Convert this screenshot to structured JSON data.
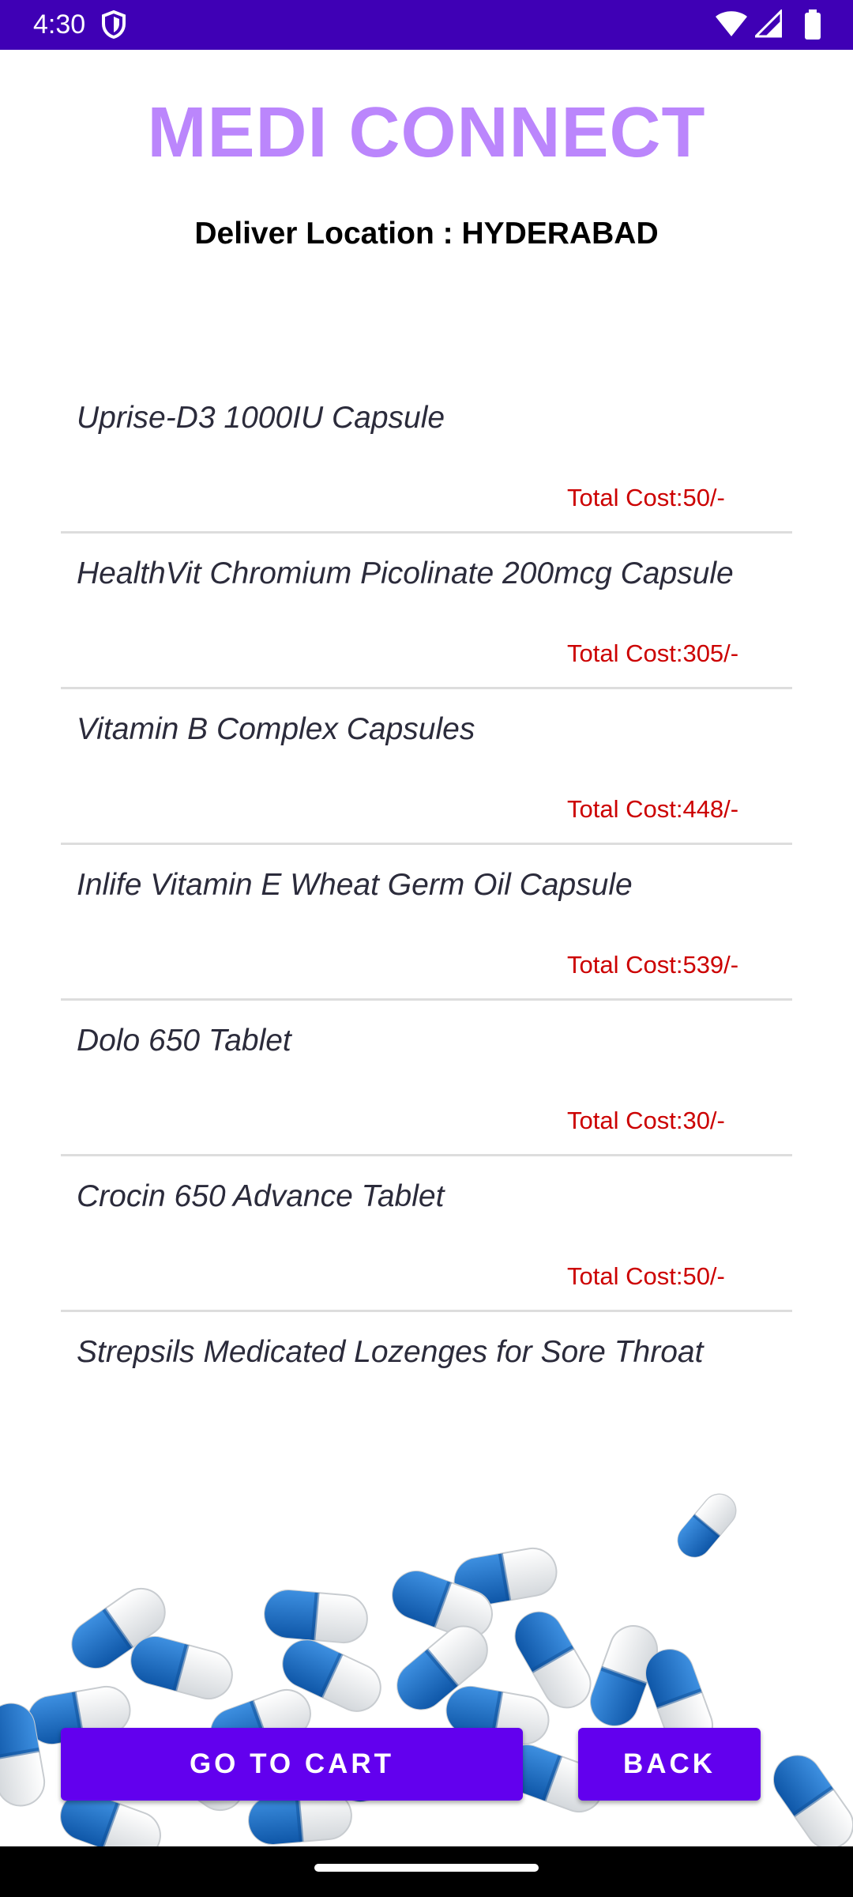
{
  "status_bar": {
    "time": "4:30",
    "icons": [
      "shield-icon",
      "wifi-icon",
      "cell-signal-icon",
      "battery-icon"
    ],
    "background": "#3f00b5"
  },
  "header": {
    "title": "MEDI CONNECT",
    "title_color": "#bb86fc",
    "deliver_location": "Deliver Location : HYDERABAD"
  },
  "medicines": [
    {
      "name": "Uprise-D3 1000IU Capsule",
      "cost": "Total Cost:50/-"
    },
    {
      "name": "HealthVit Chromium Picolinate 200mcg Capsule",
      "cost": "Total Cost:305/-"
    },
    {
      "name": "Vitamin B Complex Capsules",
      "cost": "Total Cost:448/-"
    },
    {
      "name": "Inlife Vitamin E Wheat Germ Oil Capsule",
      "cost": "Total Cost:539/-"
    },
    {
      "name": "Dolo 650 Tablet",
      "cost": "Total Cost:30/-"
    },
    {
      "name": "Crocin 650 Advance Tablet",
      "cost": "Total Cost:50/-"
    },
    {
      "name": "Strepsils Medicated Lozenges for Sore Throat",
      "cost": ""
    }
  ],
  "cost_color": "#cc0000",
  "buttons": {
    "go_to_cart": "GO TO CART",
    "back": "BACK",
    "color": "#6200ee"
  }
}
